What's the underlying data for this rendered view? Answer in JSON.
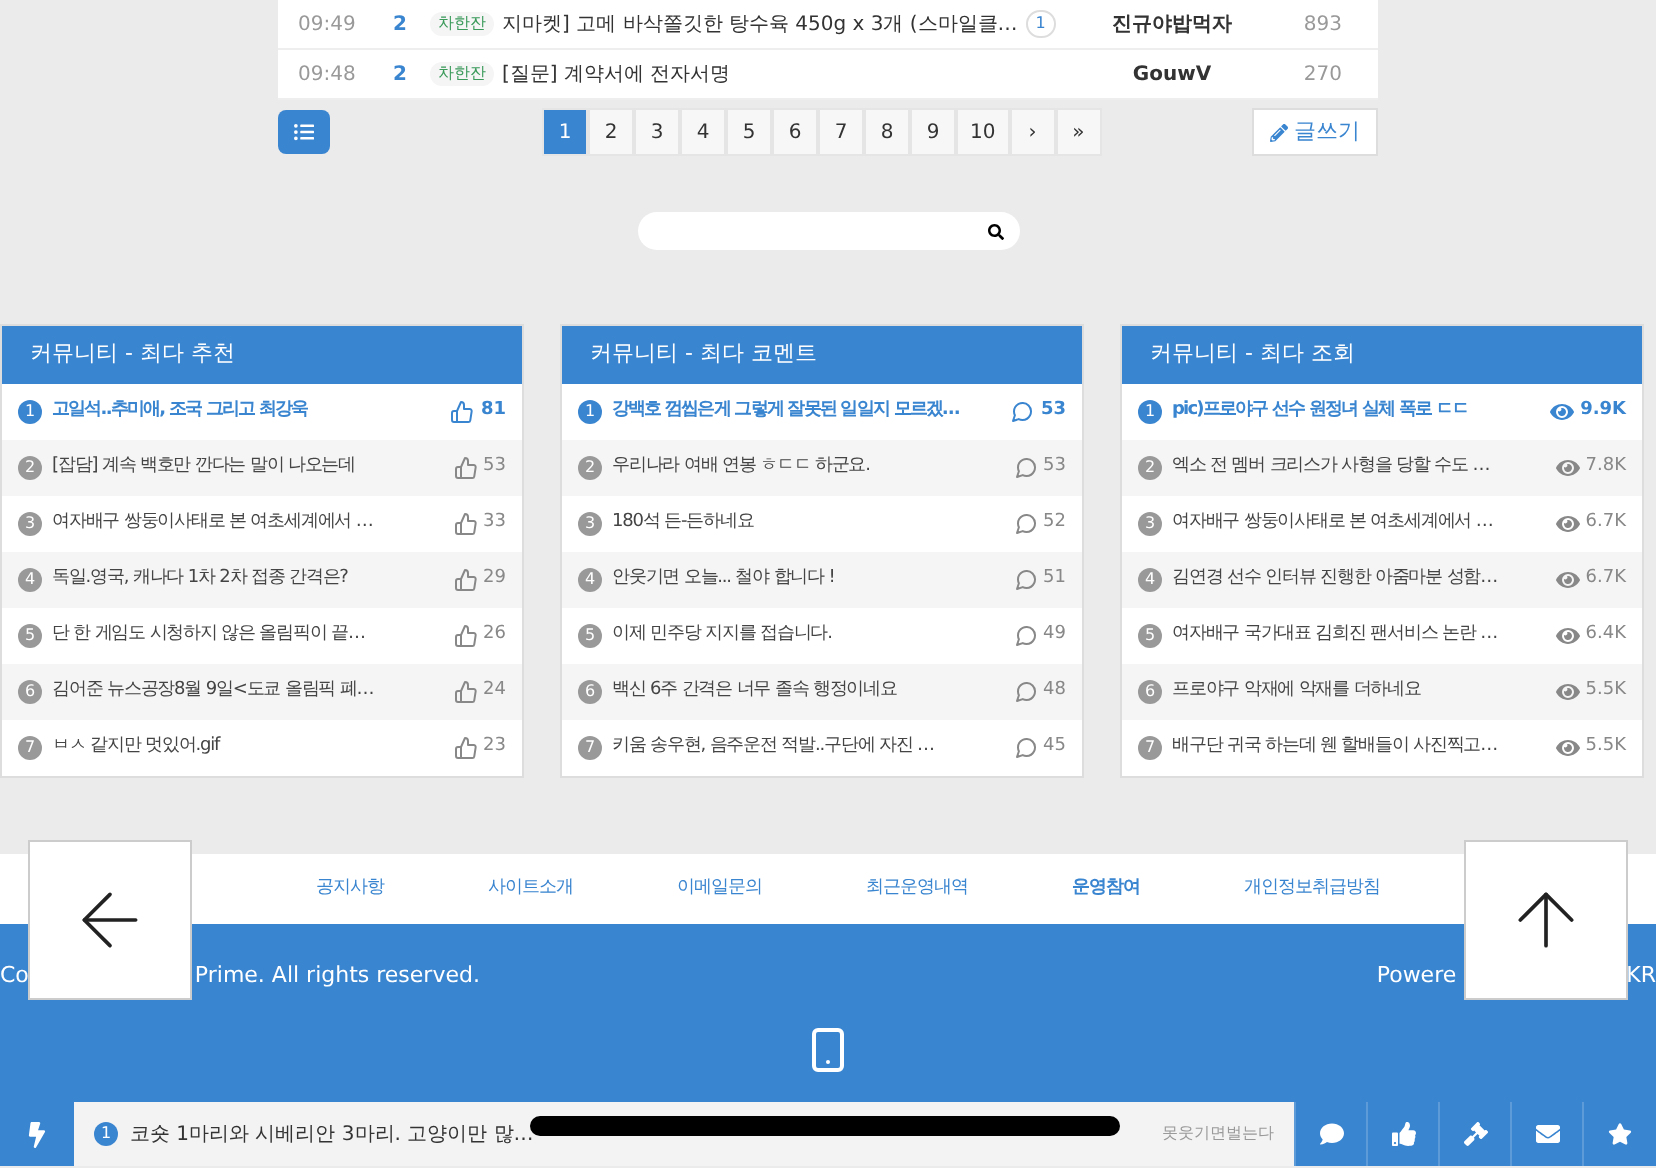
{
  "board_rows": [
    {
      "time": "09:49",
      "count": "2",
      "category": "차한잔",
      "title": "지마켓] 고메 바삭쫄깃한 탕수육 450g x 3개 (스마일클…",
      "comments": "1",
      "author": "진규야밥먹자",
      "views": "893"
    },
    {
      "time": "09:48",
      "count": "2",
      "category": "차한잔",
      "title": "[질문] 계약서에 전자서명",
      "author": "GouwV",
      "views": "270"
    }
  ],
  "pagination": [
    {
      "label": "1",
      "selected": true
    },
    {
      "label": "2",
      "selected": false
    },
    {
      "label": "3",
      "selected": false
    },
    {
      "label": "4",
      "selected": false
    },
    {
      "label": "5",
      "selected": false
    },
    {
      "label": "6",
      "selected": false
    },
    {
      "label": "7",
      "selected": false
    },
    {
      "label": "8",
      "selected": false
    },
    {
      "label": "9",
      "selected": false
    },
    {
      "label": "10",
      "selected": false
    },
    {
      "label": "›",
      "selected": false
    },
    {
      "label": "»",
      "selected": false
    }
  ],
  "write_button": "글쓰기",
  "panels": [
    {
      "title": "커뮤니티 - 최다 추천",
      "kind": "likes",
      "items": [
        {
          "rank": "1",
          "title": "고일석..추미애, 조국 그리고 최강욱",
          "value": "81"
        },
        {
          "rank": "2",
          "title": "[잡담] 계속 백호만 깐다는 말이 나오는데",
          "value": "53"
        },
        {
          "rank": "3",
          "title": "여자배구 쌍둥이사태로 본 여초세계에서 …",
          "value": "33"
        },
        {
          "rank": "4",
          "title": "독일.영국, 캐나다 1차 2차 접종 간격은?",
          "value": "29"
        },
        {
          "rank": "5",
          "title": "단 한 게임도 시청하지 않은 올림픽이 끝…",
          "value": "26"
        },
        {
          "rank": "6",
          "title": "김어준 뉴스공장8월 9일<도쿄 올림픽 폐…",
          "value": "24"
        },
        {
          "rank": "7",
          "title": "ㅂㅅ 같지만 멋있어.gif",
          "value": "23"
        }
      ]
    },
    {
      "title": "커뮤니티 - 최다 코멘트",
      "kind": "comments",
      "items": [
        {
          "rank": "1",
          "title": "강백호 껌씹은게 그렇게 잘못된 일일지 모르겠…",
          "value": "53"
        },
        {
          "rank": "2",
          "title": "우리나라 여배 연봉 ㅎㄷㄷ 하군요.",
          "value": "53"
        },
        {
          "rank": "3",
          "title": "180석 든-든하네요",
          "value": "52"
        },
        {
          "rank": "4",
          "title": "안웃기면 오늘... 철야 합니다 !",
          "value": "51"
        },
        {
          "rank": "5",
          "title": "이제 민주당 지지를 접습니다.",
          "value": "49"
        },
        {
          "rank": "6",
          "title": "백신 6주 간격은 너무 졸속 행정이네요",
          "value": "48"
        },
        {
          "rank": "7",
          "title": "키움 송우현, 음주운전 적발..구단에 자진 …",
          "value": "45"
        }
      ]
    },
    {
      "title": "커뮤니티 - 최다 조회",
      "kind": "views",
      "items": [
        {
          "rank": "1",
          "title": "pic)프로야구 선수 원정녀 실체 폭로 ㄷㄷ",
          "value": "9.9K"
        },
        {
          "rank": "2",
          "title": "엑소 전 멤버 크리스가 사형을 당할 수도 …",
          "value": "7.8K"
        },
        {
          "rank": "3",
          "title": "여자배구 쌍둥이사태로 본 여초세계에서 …",
          "value": "6.7K"
        },
        {
          "rank": "4",
          "title": "김연경 선수 인터뷰 진행한 아줌마분 성함…",
          "value": "6.7K"
        },
        {
          "rank": "5",
          "title": "여자배구 국가대표 김희진 팬서비스 논란 …",
          "value": "6.4K"
        },
        {
          "rank": "6",
          "title": "프로야구 악재에 악재를 더하네요",
          "value": "5.5K"
        },
        {
          "rank": "7",
          "title": "배구단 귀국 하는데 웬 할배들이 사진찍고…",
          "value": "5.5K"
        }
      ]
    }
  ],
  "footer_links": [
    {
      "label": "공지사항",
      "selected": false
    },
    {
      "label": "사이트소개",
      "selected": false
    },
    {
      "label": "이메일문의",
      "selected": false
    },
    {
      "label": "최근운영내역",
      "selected": false
    },
    {
      "label": "운영참여",
      "selected": true
    },
    {
      "label": "개인정보취급방침",
      "selected": false
    }
  ],
  "copyright_visible": [
    "Co",
    "Prime. All rights reserved."
  ],
  "powered_visible": [
    "Powere",
    "KR"
  ],
  "ticker": {
    "rank": "1",
    "title": "코숏 1마리와 시베리안 3마리. 고양이만 많…",
    "author_2": "못웃기면벌는다"
  }
}
